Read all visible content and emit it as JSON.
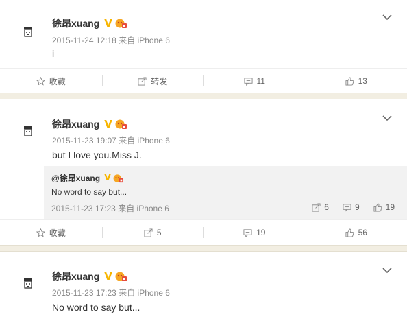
{
  "colors": {
    "verified": "#f7b500",
    "separator": "#f2eee2",
    "repost_bg": "#f2f2f2"
  },
  "icons": {
    "collect": "star-icon",
    "forward": "share-icon",
    "comment": "comment-icon",
    "like": "thumbs-up-icon",
    "menu": "chevron-down-icon"
  },
  "posts": [
    {
      "user": "徐昂xuang",
      "verified_mark": "V",
      "time": "2015-11-24 12:18",
      "source": "来自 iPhone 6",
      "text": "i",
      "actions": {
        "collect": "收藏",
        "forward": "转发",
        "comment": "11",
        "like": "13"
      }
    },
    {
      "user": "徐昂xuang",
      "verified_mark": "V",
      "time": "2015-11-23 19:07",
      "source": "来自 iPhone 6",
      "text": "but I love you.Miss J.",
      "repost": {
        "user": "@徐昂xuang",
        "verified_mark": "V",
        "text": "No word to say but...",
        "time": "2015-11-23 17:23",
        "source": "来自 iPhone 6",
        "forward": "6",
        "comment": "9",
        "like": "19"
      },
      "actions": {
        "collect": "收藏",
        "forward": "5",
        "comment": "19",
        "like": "56"
      }
    },
    {
      "user": "徐昂xuang",
      "verified_mark": "V",
      "time": "2015-11-23 17:23",
      "source": "来自 iPhone 6",
      "text": "No word to say but..."
    }
  ]
}
